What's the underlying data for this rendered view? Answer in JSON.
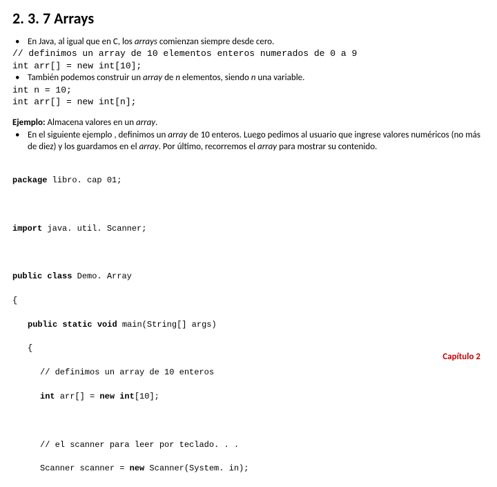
{
  "title": "2. 3. 7 Arrays",
  "b1_pre": "En Java, al igual que en C, los ",
  "b1_em": "arrays",
  "b1_post": " comienzan siempre desde cero.",
  "c1": "// definimos un array de 10 elementos enteros numerados de 0 a 9",
  "c2": "int arr[] = new int[10];",
  "b2_pre": "También podemos construir un ",
  "b2_em1": "array",
  "b2_mid1": " de ",
  "b2_em2": "n",
  "b2_mid2": " elementos, siendo ",
  "b2_em3": "n",
  "b2_post": " una variable.",
  "c3": "int n = 10;",
  "c4": "int arr[] = new int[n];",
  "ej_label": "Ejemplo: ",
  "ej_pre": "Almacena valores en un ",
  "ej_em": "array",
  "ej_post": ".",
  "b3_pre": "En el siguiente ejemplo , definimos un ",
  "b3_em1": "array",
  "b3_mid1": " de 10 enteros. Luego pedimos al usuario que ingrese valores numéricos (no más de diez) y los guardamos en el ",
  "b3_em2": "array",
  "b3_mid2": ". Por último, recorremos el ",
  "b3_em3": "array",
  "b3_post": " para mostrar su contenido.",
  "kw_package": "package",
  "pkg_rest": " libro. cap 01;",
  "kw_import": "import",
  "imp_rest": " java. util. Scanner;",
  "kw_public": "public",
  "kw_class": "class",
  "cls_rest": " Demo. Array",
  "brace_open": "{",
  "kw_static": "static",
  "kw_void": "void",
  "main_rest": " main(String[] args)",
  "cmt_arr": "// definimos un array de 10 enteros",
  "kw_int": "int",
  "arr_decl_mid": " arr[] = ",
  "kw_new": "new",
  "kw_int2": "int",
  "arr_decl_end": "[10];",
  "cmt_scan": "// el scanner para leer por teclado. . .",
  "scan_pre": "Scanner scanner = ",
  "scan_post": " Scanner(System. in);",
  "footer": "Capítulo 2"
}
